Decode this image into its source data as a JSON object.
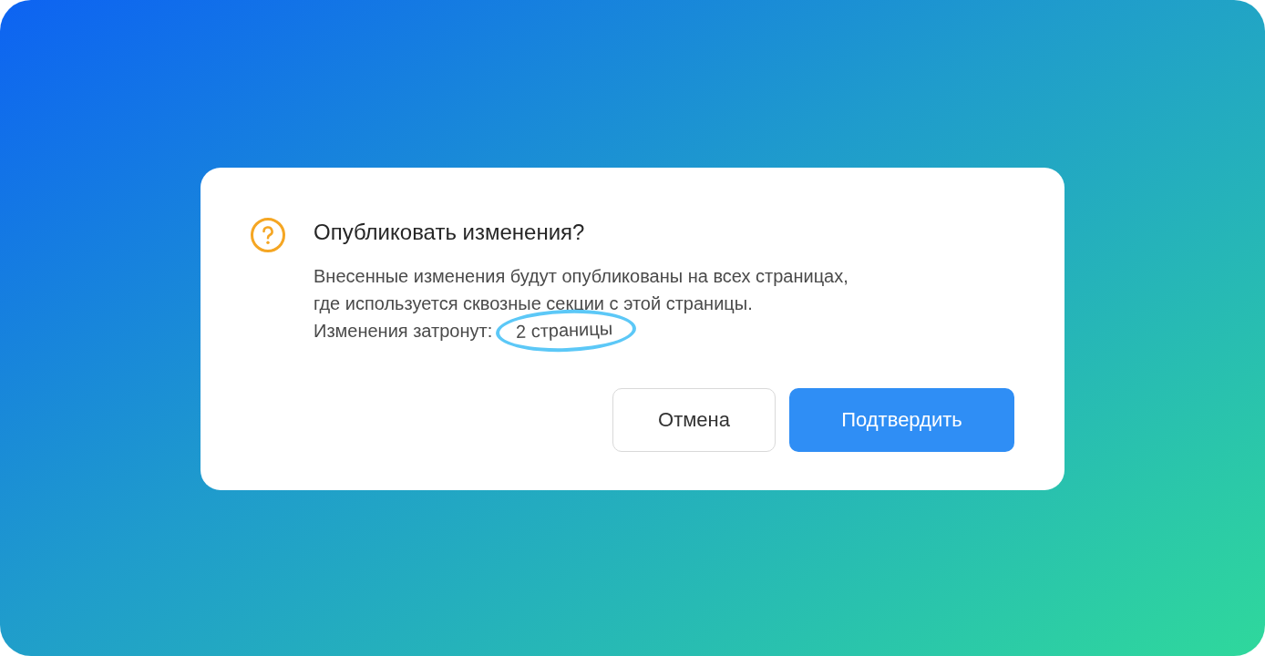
{
  "dialog": {
    "title": "Опубликовать изменения?",
    "message_lines": [
      "Внесенные изменения будут опубликованы на всех страницах,",
      "где используется сквозные секции с этой страницы."
    ],
    "affected": {
      "label": "Изменения затронут:",
      "value": "2 страницы"
    },
    "buttons": [
      {
        "label": "Отмена",
        "kind": "secondary"
      },
      {
        "label": "Подтвердить",
        "kind": "primary"
      }
    ]
  }
}
